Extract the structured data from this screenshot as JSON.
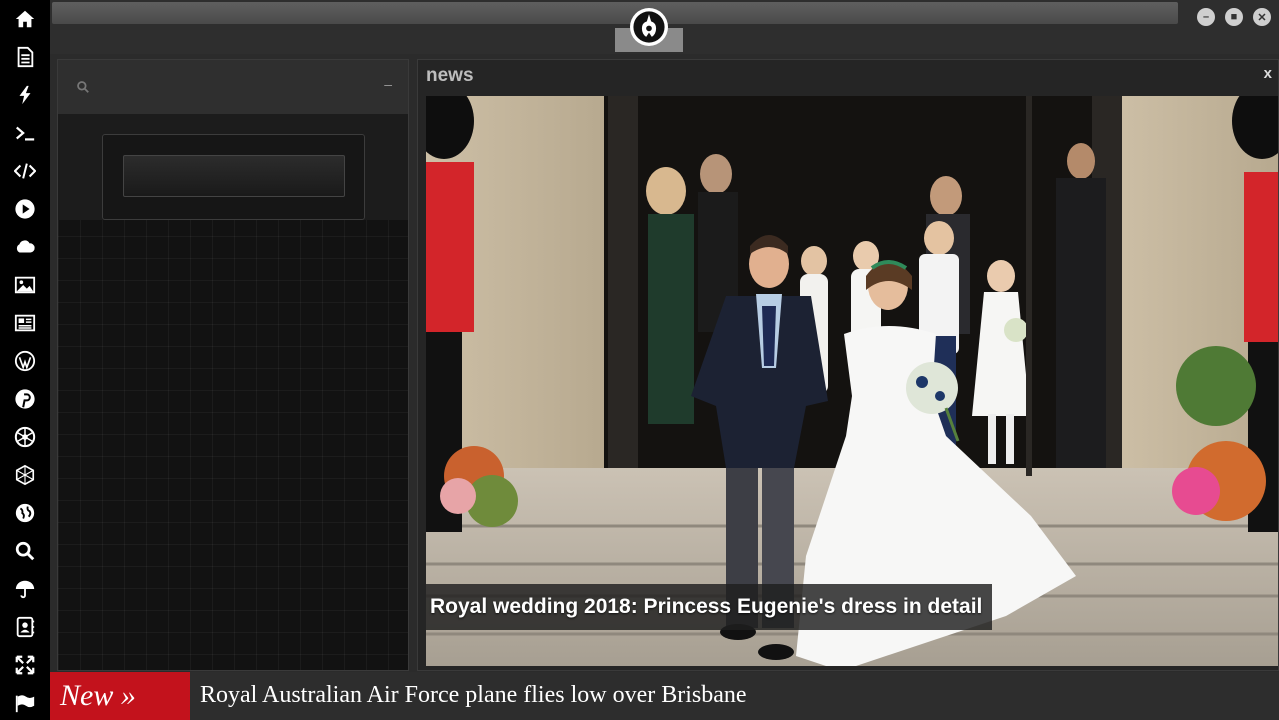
{
  "rail": {
    "icons": [
      "home-icon",
      "document-icon",
      "lightning-icon",
      "terminal-icon",
      "code-icon",
      "play-icon",
      "cloud-icon",
      "image-icon",
      "newspaper-icon",
      "wordpress-icon",
      "pinterest-icon",
      "rebel-alliance-icon",
      "empire-icon",
      "globe-icon",
      "search-icon",
      "umbrella-icon",
      "contacts-icon",
      "expand-icon",
      "flag-icon"
    ]
  },
  "topbar": {
    "logo": "rebel-alliance-logo",
    "window_buttons": [
      "minimize-icon",
      "maximize-icon",
      "close-icon"
    ]
  },
  "left_panel": {
    "search_icon": "search-icon",
    "minimize_label": "–",
    "input_value": ""
  },
  "news": {
    "title": "news",
    "close_label": "x",
    "headline": "Royal wedding 2018: Princess Eugenie's dress in detail"
  },
  "ticker": {
    "badge": "New »",
    "text": "Royal Australian Air Force plane flies low over Brisbane"
  },
  "colors": {
    "rail_bg": "#000000",
    "panel_bg": "#2b2b2b",
    "ticker_badge": "#c3121c",
    "headline_text": "#ffffff"
  }
}
